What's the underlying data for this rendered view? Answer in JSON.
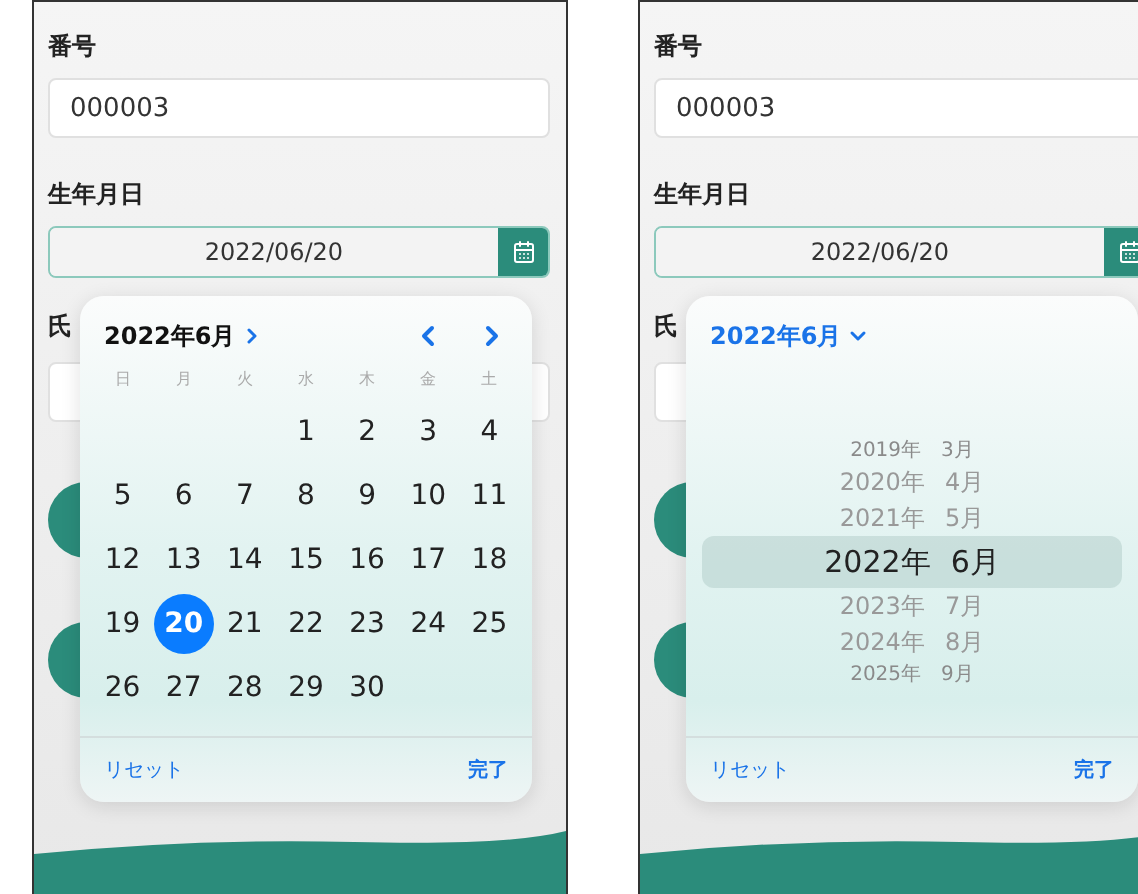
{
  "screens": [
    {
      "fields": [
        {
          "kind": "text",
          "label": "番号",
          "value": "000003"
        },
        {
          "kind": "date",
          "label": "生年月日",
          "value": "2022/06/20"
        }
      ],
      "covered_label": "氏",
      "picker": {
        "kind": "calendar",
        "title": "2022年6月",
        "weekdays": [
          "日",
          "月",
          "火",
          "水",
          "木",
          "金",
          "土"
        ],
        "weeks": [
          [
            {
              "label": "1",
              "selected": false
            },
            {
              "label": "2",
              "selected": false
            },
            {
              "label": "3",
              "selected": false
            },
            {
              "label": "4",
              "selected": false
            }
          ],
          [
            {
              "label": "5",
              "selected": false
            },
            {
              "label": "6",
              "selected": false
            },
            {
              "label": "7",
              "selected": false
            },
            {
              "label": "8",
              "selected": false
            },
            {
              "label": "9",
              "selected": false
            },
            {
              "label": "10",
              "selected": false
            },
            {
              "label": "11",
              "selected": false
            }
          ],
          [
            {
              "label": "12",
              "selected": false
            },
            {
              "label": "13",
              "selected": false
            },
            {
              "label": "14",
              "selected": false
            },
            {
              "label": "15",
              "selected": false
            },
            {
              "label": "16",
              "selected": false
            },
            {
              "label": "17",
              "selected": false
            },
            {
              "label": "18",
              "selected": false
            }
          ],
          [
            {
              "label": "19",
              "selected": false
            },
            {
              "label": "20",
              "selected": true
            },
            {
              "label": "21",
              "selected": false
            },
            {
              "label": "22",
              "selected": false
            },
            {
              "label": "23",
              "selected": false
            },
            {
              "label": "24",
              "selected": false
            },
            {
              "label": "25",
              "selected": false
            }
          ],
          [
            {
              "label": "26",
              "selected": false
            },
            {
              "label": "27",
              "selected": false
            },
            {
              "label": "28",
              "selected": false
            },
            {
              "label": "29",
              "selected": false
            },
            {
              "label": "30",
              "selected": false
            }
          ]
        ],
        "reset": "リセット",
        "done": "完了"
      }
    },
    {
      "fields": [
        {
          "kind": "text",
          "label": "番号",
          "value": "000003"
        },
        {
          "kind": "date",
          "label": "生年月日",
          "value": "2022/06/20"
        }
      ],
      "covered_label": "氏",
      "picker": {
        "kind": "wheel",
        "title": "2022年6月",
        "rows": [
          {
            "year": "2019年",
            "month": "3月",
            "selected": false
          },
          {
            "year": "2020年",
            "month": "4月",
            "selected": false
          },
          {
            "year": "2021年",
            "month": "5月",
            "selected": false
          },
          {
            "year": "2022年",
            "month": "6月",
            "selected": true
          },
          {
            "year": "2023年",
            "month": "7月",
            "selected": false
          },
          {
            "year": "2024年",
            "month": "8月",
            "selected": false
          },
          {
            "year": "2025年",
            "month": "9月",
            "selected": false
          }
        ],
        "reset": "リセット",
        "done": "完了"
      }
    }
  ]
}
